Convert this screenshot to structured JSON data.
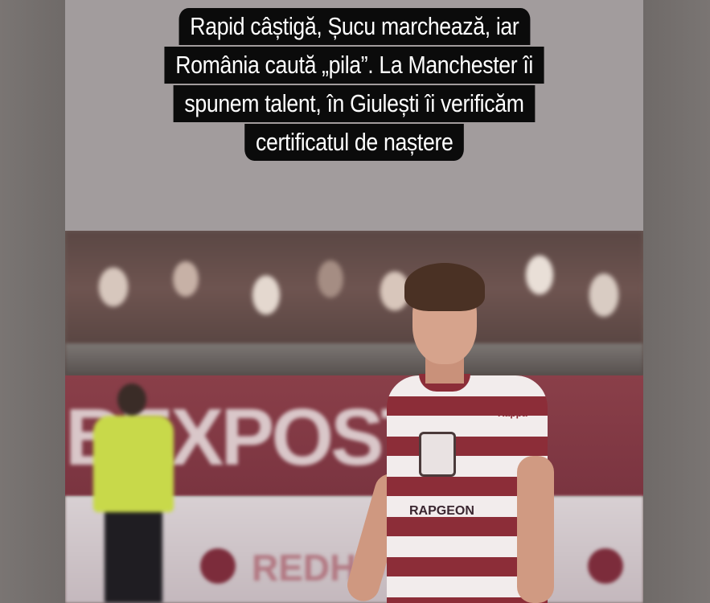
{
  "story": {
    "caption_lines": [
      "Rapid câștigă, Șucu marchează, iar",
      "România caută „pila”. La Manchester îi",
      "spunem talent, în Giulești îi verificăm",
      "certificatul de naștere"
    ]
  },
  "photo": {
    "banner_text": "BEXPOST",
    "ad_text": "REDHO",
    "jersey_sponsor": "RAPGEON",
    "jersey_brand": "Kappa"
  },
  "colors": {
    "caption_bg": "#0b0b0b",
    "caption_text": "#ffffff",
    "story_bg": "#a29c9d",
    "kit_red": "#8c2d38",
    "kit_white": "#f2ecec"
  }
}
